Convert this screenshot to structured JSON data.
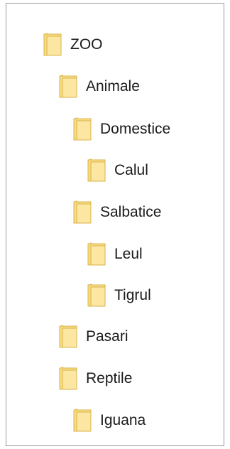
{
  "tree": {
    "items": [
      {
        "label": "ZOO",
        "level": 0,
        "icon": "folder-icon"
      },
      {
        "label": "Animale",
        "level": 1,
        "icon": "folder-icon"
      },
      {
        "label": "Domestice",
        "level": 2,
        "icon": "folder-icon"
      },
      {
        "label": "Calul",
        "level": 3,
        "icon": "folder-icon"
      },
      {
        "label": "Salbatice",
        "level": 2,
        "icon": "folder-icon"
      },
      {
        "label": "Leul",
        "level": 3,
        "icon": "folder-icon"
      },
      {
        "label": "Tigrul",
        "level": 3,
        "icon": "folder-icon"
      },
      {
        "label": "Pasari",
        "level": 1,
        "icon": "folder-icon"
      },
      {
        "label": "Reptile",
        "level": 1,
        "icon": "folder-icon"
      },
      {
        "label": "Iguana",
        "level": 2,
        "icon": "folder-icon"
      }
    ]
  },
  "colors": {
    "folder_fill": "#f8dc84",
    "folder_edge": "#d9b44a",
    "border": "#9a9a9a"
  }
}
